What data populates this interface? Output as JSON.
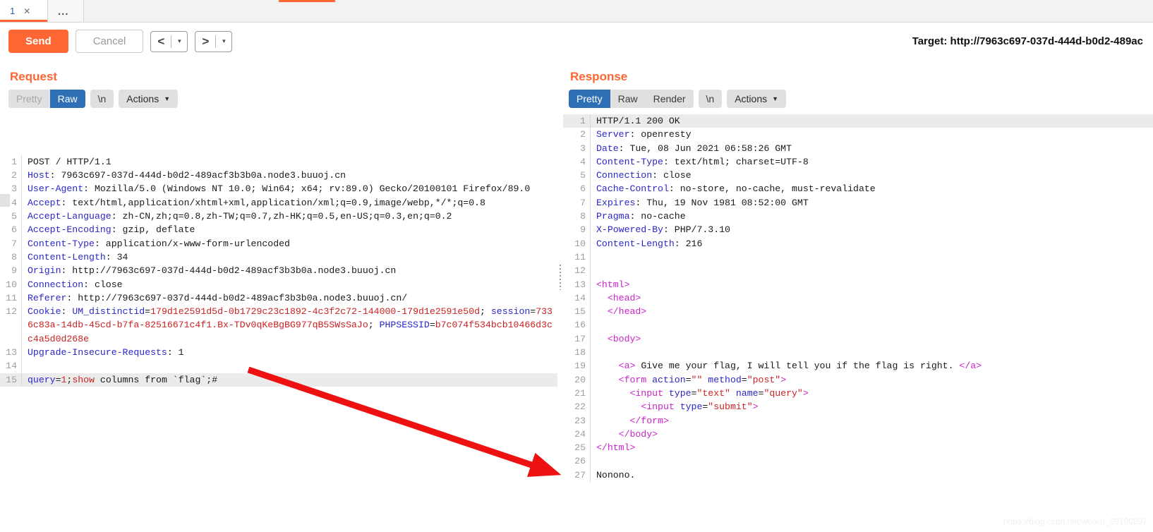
{
  "window": {
    "tab": {
      "label": "1",
      "close_icon": "close-icon"
    },
    "more_tabs": "..."
  },
  "toolbar": {
    "send_label": "Send",
    "cancel_label": "Cancel",
    "prev_icon": "<",
    "next_icon": ">",
    "dropdown_caret": "▾",
    "target_label": "Target: http://7963c697-037d-444d-b0d2-489ac"
  },
  "request": {
    "title": "Request",
    "tabs": [
      {
        "label": "Pretty",
        "active": false,
        "dimmed": true
      },
      {
        "label": "Raw",
        "active": true,
        "dimmed": false
      }
    ],
    "newline_label": "\\n",
    "actions_label": "Actions",
    "lines": [
      {
        "n": "1",
        "segs": [
          {
            "t": "POST / HTTP/1.1",
            "c": "k-plain"
          }
        ]
      },
      {
        "n": "2",
        "segs": [
          {
            "t": "Host",
            "c": "k-hdr"
          },
          {
            "t": ": 7963c697-037d-444d-b0d2-489acf3b3b0a.node3.buuoj.cn",
            "c": "k-plain"
          }
        ]
      },
      {
        "n": "3",
        "segs": [
          {
            "t": "User-Agent",
            "c": "k-hdr"
          },
          {
            "t": ": Mozilla/5.0 (Windows NT 10.0; Win64; x64; rv:89.0) Gecko/20100101 Firefox/89.0",
            "c": "k-plain"
          }
        ]
      },
      {
        "n": "4",
        "segs": [
          {
            "t": "Accept",
            "c": "k-hdr"
          },
          {
            "t": ": text/html,application/xhtml+xml,application/xml;q=0.9,image/webp,*/*;q=0.8",
            "c": "k-plain"
          }
        ]
      },
      {
        "n": "5",
        "segs": [
          {
            "t": "Accept-Language",
            "c": "k-hdr"
          },
          {
            "t": ": zh-CN,zh;q=0.8,zh-TW;q=0.7,zh-HK;q=0.5,en-US;q=0.3,en;q=0.2",
            "c": "k-plain"
          }
        ]
      },
      {
        "n": "6",
        "segs": [
          {
            "t": "Accept-Encoding",
            "c": "k-hdr"
          },
          {
            "t": ": gzip, deflate",
            "c": "k-plain"
          }
        ]
      },
      {
        "n": "7",
        "segs": [
          {
            "t": "Content-Type",
            "c": "k-hdr"
          },
          {
            "t": ": application/x-www-form-urlencoded",
            "c": "k-plain"
          }
        ]
      },
      {
        "n": "8",
        "segs": [
          {
            "t": "Content-Length",
            "c": "k-hdr"
          },
          {
            "t": ": 34",
            "c": "k-plain"
          }
        ]
      },
      {
        "n": "9",
        "segs": [
          {
            "t": "Origin",
            "c": "k-hdr"
          },
          {
            "t": ": http://7963c697-037d-444d-b0d2-489acf3b3b0a.node3.buuoj.cn",
            "c": "k-plain"
          }
        ]
      },
      {
        "n": "10",
        "segs": [
          {
            "t": "Connection",
            "c": "k-hdr"
          },
          {
            "t": ": close",
            "c": "k-plain"
          }
        ]
      },
      {
        "n": "11",
        "segs": [
          {
            "t": "Referer",
            "c": "k-hdr"
          },
          {
            "t": ": http://7963c697-037d-444d-b0d2-489acf3b3b0a.node3.buuoj.cn/",
            "c": "k-plain"
          }
        ]
      },
      {
        "n": "12",
        "segs": [
          {
            "t": "Cookie",
            "c": "k-hdr"
          },
          {
            "t": ": ",
            "c": "k-plain"
          },
          {
            "t": "UM_distinctid",
            "c": "k-blue"
          },
          {
            "t": "=",
            "c": "k-plain"
          },
          {
            "t": "179d1e2591d5d-0b1729c23c1892-4c3f2c72-144000-179d1e2591e50d",
            "c": "k-red"
          },
          {
            "t": "; ",
            "c": "k-plain"
          },
          {
            "t": "session",
            "c": "k-blue"
          },
          {
            "t": "=",
            "c": "k-plain"
          },
          {
            "t": "7336c83a-14db-45cd-b7fa-82516671c4f1.Bx-TDv0qKeBgBG977qB5SWsSaJo",
            "c": "k-red"
          },
          {
            "t": "; ",
            "c": "k-plain"
          },
          {
            "t": "PHPSESSID",
            "c": "k-blue"
          },
          {
            "t": "=",
            "c": "k-plain"
          },
          {
            "t": "b7c074f534bcb10466d3cc4a5d0d268e",
            "c": "k-red"
          }
        ]
      },
      {
        "n": "13",
        "segs": [
          {
            "t": "Upgrade-Insecure-Requests",
            "c": "k-hdr"
          },
          {
            "t": ": 1",
            "c": "k-plain"
          }
        ]
      },
      {
        "n": "14",
        "segs": [
          {
            "t": "",
            "c": "k-plain"
          }
        ]
      },
      {
        "n": "15",
        "highlight": true,
        "segs": [
          {
            "t": "query",
            "c": "k-blue"
          },
          {
            "t": "=",
            "c": "k-plain"
          },
          {
            "t": "1",
            "c": "k-red"
          },
          {
            "t": ";",
            "c": "k-plain"
          },
          {
            "t": "show",
            "c": "k-red"
          },
          {
            "t": " columns from `flag`;#",
            "c": "k-plain"
          }
        ]
      }
    ]
  },
  "response": {
    "title": "Response",
    "tabs": [
      {
        "label": "Pretty",
        "active": true,
        "dimmed": false
      },
      {
        "label": "Raw",
        "active": false,
        "dimmed": false
      },
      {
        "label": "Render",
        "active": false,
        "dimmed": false
      }
    ],
    "newline_label": "\\n",
    "actions_label": "Actions",
    "lines": [
      {
        "n": "1",
        "highlight": true,
        "segs": [
          {
            "t": "HTTP/1.1 200 OK",
            "c": "k-plain"
          }
        ]
      },
      {
        "n": "2",
        "segs": [
          {
            "t": "Server",
            "c": "k-hdr"
          },
          {
            "t": ": openresty",
            "c": "k-plain"
          }
        ]
      },
      {
        "n": "3",
        "segs": [
          {
            "t": "Date",
            "c": "k-hdr"
          },
          {
            "t": ": Tue, 08 Jun 2021 06:58:26 GMT",
            "c": "k-plain"
          }
        ]
      },
      {
        "n": "4",
        "segs": [
          {
            "t": "Content-Type",
            "c": "k-hdr"
          },
          {
            "t": ": text/html; charset=UTF-8",
            "c": "k-plain"
          }
        ]
      },
      {
        "n": "5",
        "segs": [
          {
            "t": "Connection",
            "c": "k-hdr"
          },
          {
            "t": ": close",
            "c": "k-plain"
          }
        ]
      },
      {
        "n": "6",
        "segs": [
          {
            "t": "Cache-Control",
            "c": "k-hdr"
          },
          {
            "t": ": no-store, no-cache, must-revalidate",
            "c": "k-plain"
          }
        ]
      },
      {
        "n": "7",
        "segs": [
          {
            "t": "Expires",
            "c": "k-hdr"
          },
          {
            "t": ": Thu, 19 Nov 1981 08:52:00 GMT",
            "c": "k-plain"
          }
        ]
      },
      {
        "n": "8",
        "segs": [
          {
            "t": "Pragma",
            "c": "k-hdr"
          },
          {
            "t": ": no-cache",
            "c": "k-plain"
          }
        ]
      },
      {
        "n": "9",
        "segs": [
          {
            "t": "X-Powered-By",
            "c": "k-hdr"
          },
          {
            "t": ": PHP/7.3.10",
            "c": "k-plain"
          }
        ]
      },
      {
        "n": "10",
        "segs": [
          {
            "t": "Content-Length",
            "c": "k-hdr"
          },
          {
            "t": ": 216",
            "c": "k-plain"
          }
        ]
      },
      {
        "n": "11",
        "segs": [
          {
            "t": "",
            "c": "k-plain"
          }
        ]
      },
      {
        "n": "12",
        "segs": [
          {
            "t": "",
            "c": "k-plain"
          }
        ]
      },
      {
        "n": "13",
        "segs": [
          {
            "t": "<html>",
            "c": "k-tag"
          }
        ]
      },
      {
        "n": "14",
        "segs": [
          {
            "t": "  <head>",
            "c": "k-tag"
          }
        ]
      },
      {
        "n": "15",
        "segs": [
          {
            "t": "  </head>",
            "c": "k-tag"
          }
        ]
      },
      {
        "n": "16",
        "segs": [
          {
            "t": "",
            "c": "k-plain"
          }
        ]
      },
      {
        "n": "17",
        "segs": [
          {
            "t": "  <body>",
            "c": "k-tag"
          }
        ]
      },
      {
        "n": "18",
        "segs": [
          {
            "t": "",
            "c": "k-plain"
          }
        ]
      },
      {
        "n": "19",
        "segs": [
          {
            "t": "    <a>",
            "c": "k-tag"
          },
          {
            "t": " Give me your flag, I will tell you if the flag is right. ",
            "c": "k-plain"
          },
          {
            "t": "</a>",
            "c": "k-tag"
          }
        ]
      },
      {
        "n": "20",
        "segs": [
          {
            "t": "    <form ",
            "c": "k-tag"
          },
          {
            "t": "action",
            "c": "k-attr"
          },
          {
            "t": "=",
            "c": "k-plain"
          },
          {
            "t": "\"\"",
            "c": "k-str"
          },
          {
            "t": " ",
            "c": "k-plain"
          },
          {
            "t": "method",
            "c": "k-attr"
          },
          {
            "t": "=",
            "c": "k-plain"
          },
          {
            "t": "\"post\"",
            "c": "k-str"
          },
          {
            "t": ">",
            "c": "k-tag"
          }
        ]
      },
      {
        "n": "21",
        "segs": [
          {
            "t": "      <input ",
            "c": "k-tag"
          },
          {
            "t": "type",
            "c": "k-attr"
          },
          {
            "t": "=",
            "c": "k-plain"
          },
          {
            "t": "\"text\"",
            "c": "k-str"
          },
          {
            "t": " ",
            "c": "k-plain"
          },
          {
            "t": "name",
            "c": "k-attr"
          },
          {
            "t": "=",
            "c": "k-plain"
          },
          {
            "t": "\"query\"",
            "c": "k-str"
          },
          {
            "t": ">",
            "c": "k-tag"
          }
        ]
      },
      {
        "n": "22",
        "segs": [
          {
            "t": "        <input ",
            "c": "k-tag"
          },
          {
            "t": "type",
            "c": "k-attr"
          },
          {
            "t": "=",
            "c": "k-plain"
          },
          {
            "t": "\"submit\"",
            "c": "k-str"
          },
          {
            "t": ">",
            "c": "k-tag"
          }
        ]
      },
      {
        "n": "23",
        "segs": [
          {
            "t": "      </form>",
            "c": "k-tag"
          }
        ]
      },
      {
        "n": "24",
        "segs": [
          {
            "t": "    </body>",
            "c": "k-tag"
          }
        ]
      },
      {
        "n": "25",
        "segs": [
          {
            "t": "</html>",
            "c": "k-tag"
          }
        ]
      },
      {
        "n": "26",
        "segs": [
          {
            "t": "",
            "c": "k-plain"
          }
        ]
      },
      {
        "n": "27",
        "segs": [
          {
            "t": "Nonono.",
            "c": "k-plain"
          }
        ]
      }
    ]
  },
  "annotation": {
    "arrow_color": "#ee1111",
    "arrow_name": "red-arrow-annotation"
  },
  "watermark": "https://blog.csdn.net/weixin_39190897",
  "colors": {
    "accent": "#ff6633",
    "active_tab": "#2f6fb5",
    "header_key": "#2a27c9",
    "string_red": "#cc2222",
    "tag_magenta": "#cc22cc"
  }
}
